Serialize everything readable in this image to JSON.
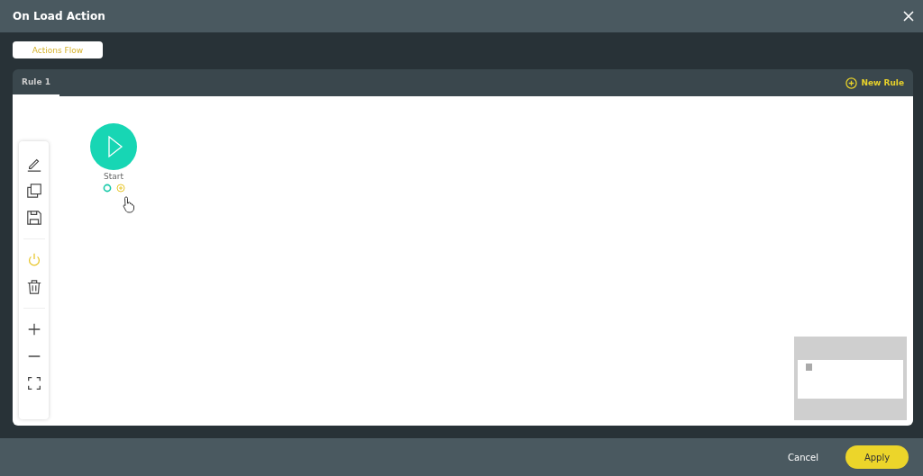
{
  "window": {
    "title": "On Load Action"
  },
  "view_button": {
    "label": "Actions Flow"
  },
  "tabs": [
    {
      "label": "Rule 1",
      "selected": true
    }
  ],
  "new_rule": {
    "label": "New Rule"
  },
  "flow_active": true,
  "nodes": [
    {
      "label": "Start",
      "kind": "start"
    }
  ],
  "buttons": [
    {
      "label": "Cancel",
      "kind": "secondary"
    },
    {
      "label": "Apply",
      "kind": "primary"
    }
  ]
}
